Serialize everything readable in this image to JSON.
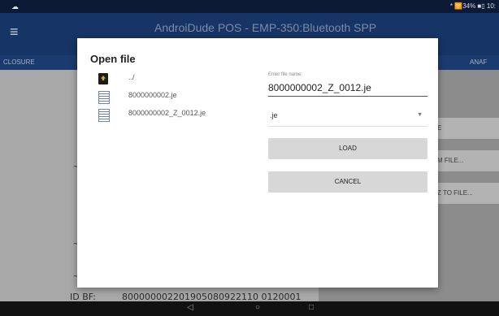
{
  "statusbar": {
    "left_icon": "cloud-icon",
    "right_text": "* 🛜34% ■▯ 10:"
  },
  "appbar": {
    "menu_icon": "≡",
    "title": "AndroiDude POS - EMP-350:Bluetooth SPP"
  },
  "tabs": {
    "closure": "CLOSURE",
    "anaf": "ANAF"
  },
  "background_buttons": [
    "E",
    "M FILE...",
    "Z TO FILE..."
  ],
  "background": {
    "id_bf_label": "ID BF:",
    "id_bf_value": "800000002201905080922110 0120001"
  },
  "dialog": {
    "title": "Open file",
    "files": [
      {
        "name": "../",
        "icon": "folder-up-icon"
      },
      {
        "name": "8000000002.je",
        "icon": "file-icon"
      },
      {
        "name": "8000000002_Z_0012.je",
        "icon": "file-icon"
      }
    ],
    "filename_label": "Enter file name:",
    "filename_value": "8000000002_Z_0012.je",
    "extension": ".je",
    "load_label": "LOAD",
    "cancel_label": "CANCEL"
  },
  "navbar": {
    "back": "◁",
    "home": "○",
    "recents": "□"
  },
  "colors": {
    "appbar": "#163466",
    "statusbar": "#0d1a35",
    "dialog_button": "#d7d7d7"
  }
}
